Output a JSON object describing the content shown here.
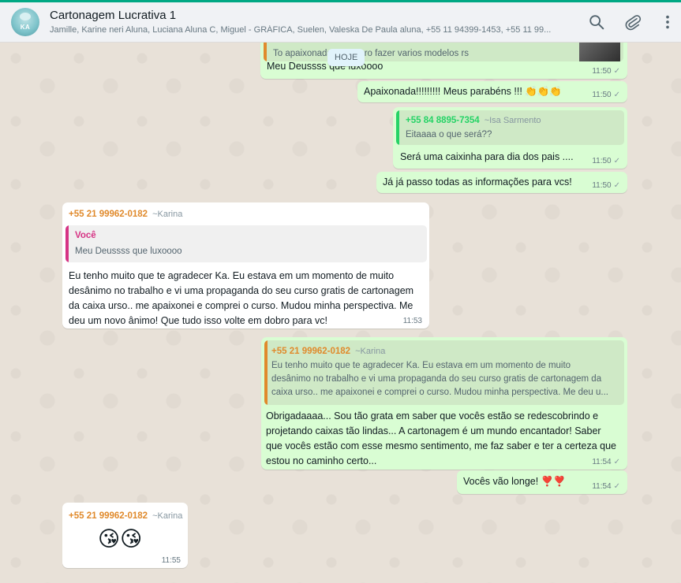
{
  "header": {
    "title": "Cartonagem Lucrativa 1",
    "subtitle": "Jamille, Karine neri Aluna, Luciana Aluna C, Miguel - GRÁFICA, Suelen, Valeska De Paula aluna, +55 11 94399-1453, +55 11 99...",
    "avatar_text": "KA",
    "icons": [
      "search-icon",
      "attach-icon",
      "menu-icon"
    ]
  },
  "date_chip": "HOJE",
  "messages": {
    "m0": {
      "quote_text": "To apaixonada. Ja quero fazer varios modelos rs",
      "text": "Meu Deussss que luxoooo",
      "time": "11:50"
    },
    "m1": {
      "text": "Apaixonada!!!!!!!!! Meus parabéns !!! 👏👏👏",
      "time": "11:50"
    },
    "m2": {
      "quote_sender": "+55 84 8895-7354",
      "quote_alias": "~Isa Sarmento",
      "quote_text": "Eitaaaa o que será??",
      "text": "Será uma caixinha para dia dos pais ....",
      "time": "11:50"
    },
    "m3": {
      "text": "Já já passo todas as informações para vcs!",
      "time": "11:50"
    },
    "m4": {
      "sender": "+55 21 99962-0182",
      "alias": "~Karina",
      "quote_sender": "Você",
      "quote_text": "Meu Deussss que luxoooo",
      "lines": [
        "Eu tenho muito que te agradecer Ka. Eu estava em um momento de muito",
        "desânimo no trabalho e vi uma propaganda do seu curso gratis de cartonagem",
        "da caixa urso.. me apaixonei e comprei o curso. Mudou minha perspectiva. Me",
        "deu um novo ânimo! Que tudo isso volte em dobro para vc!"
      ],
      "time": "11:53"
    },
    "m5": {
      "quote_sender": "+55 21 99962-0182",
      "quote_alias": "~Karina",
      "quote_lines": [
        "Eu tenho muito que te agradecer Ka. Eu estava em um momento de muito",
        "desânimo no trabalho e vi uma propaganda do seu curso gratis de cartonagem da",
        "caixa urso.. me apaixonei e comprei o curso. Mudou minha perspectiva. Me deu u..."
      ],
      "lines": [
        "Obrigadaaaa... Sou tão grata em saber que vocês estão se redescobrindo e",
        "projetando caixas tão lindas... A cartonagem é um mundo encantador! Saber",
        "que vocês estão com esse mesmo sentimento, me faz saber e ter a certeza que",
        "estou no caminho certo..."
      ],
      "time": "11:54"
    },
    "m6": {
      "text": "Vocês vão longe! ❣️❣️",
      "time": "11:54"
    },
    "m7": {
      "sender": "+55 21 99962-0182",
      "alias": "~Karina",
      "text": "😘😘",
      "time": "11:55"
    }
  },
  "colors": {
    "out_bubble": "#d9fdd3",
    "in_bubble": "#ffffff",
    "karina": "#e08a2c",
    "isa": "#25d366",
    "voce": "#d63384",
    "header_bg": "#f0f2f5"
  }
}
